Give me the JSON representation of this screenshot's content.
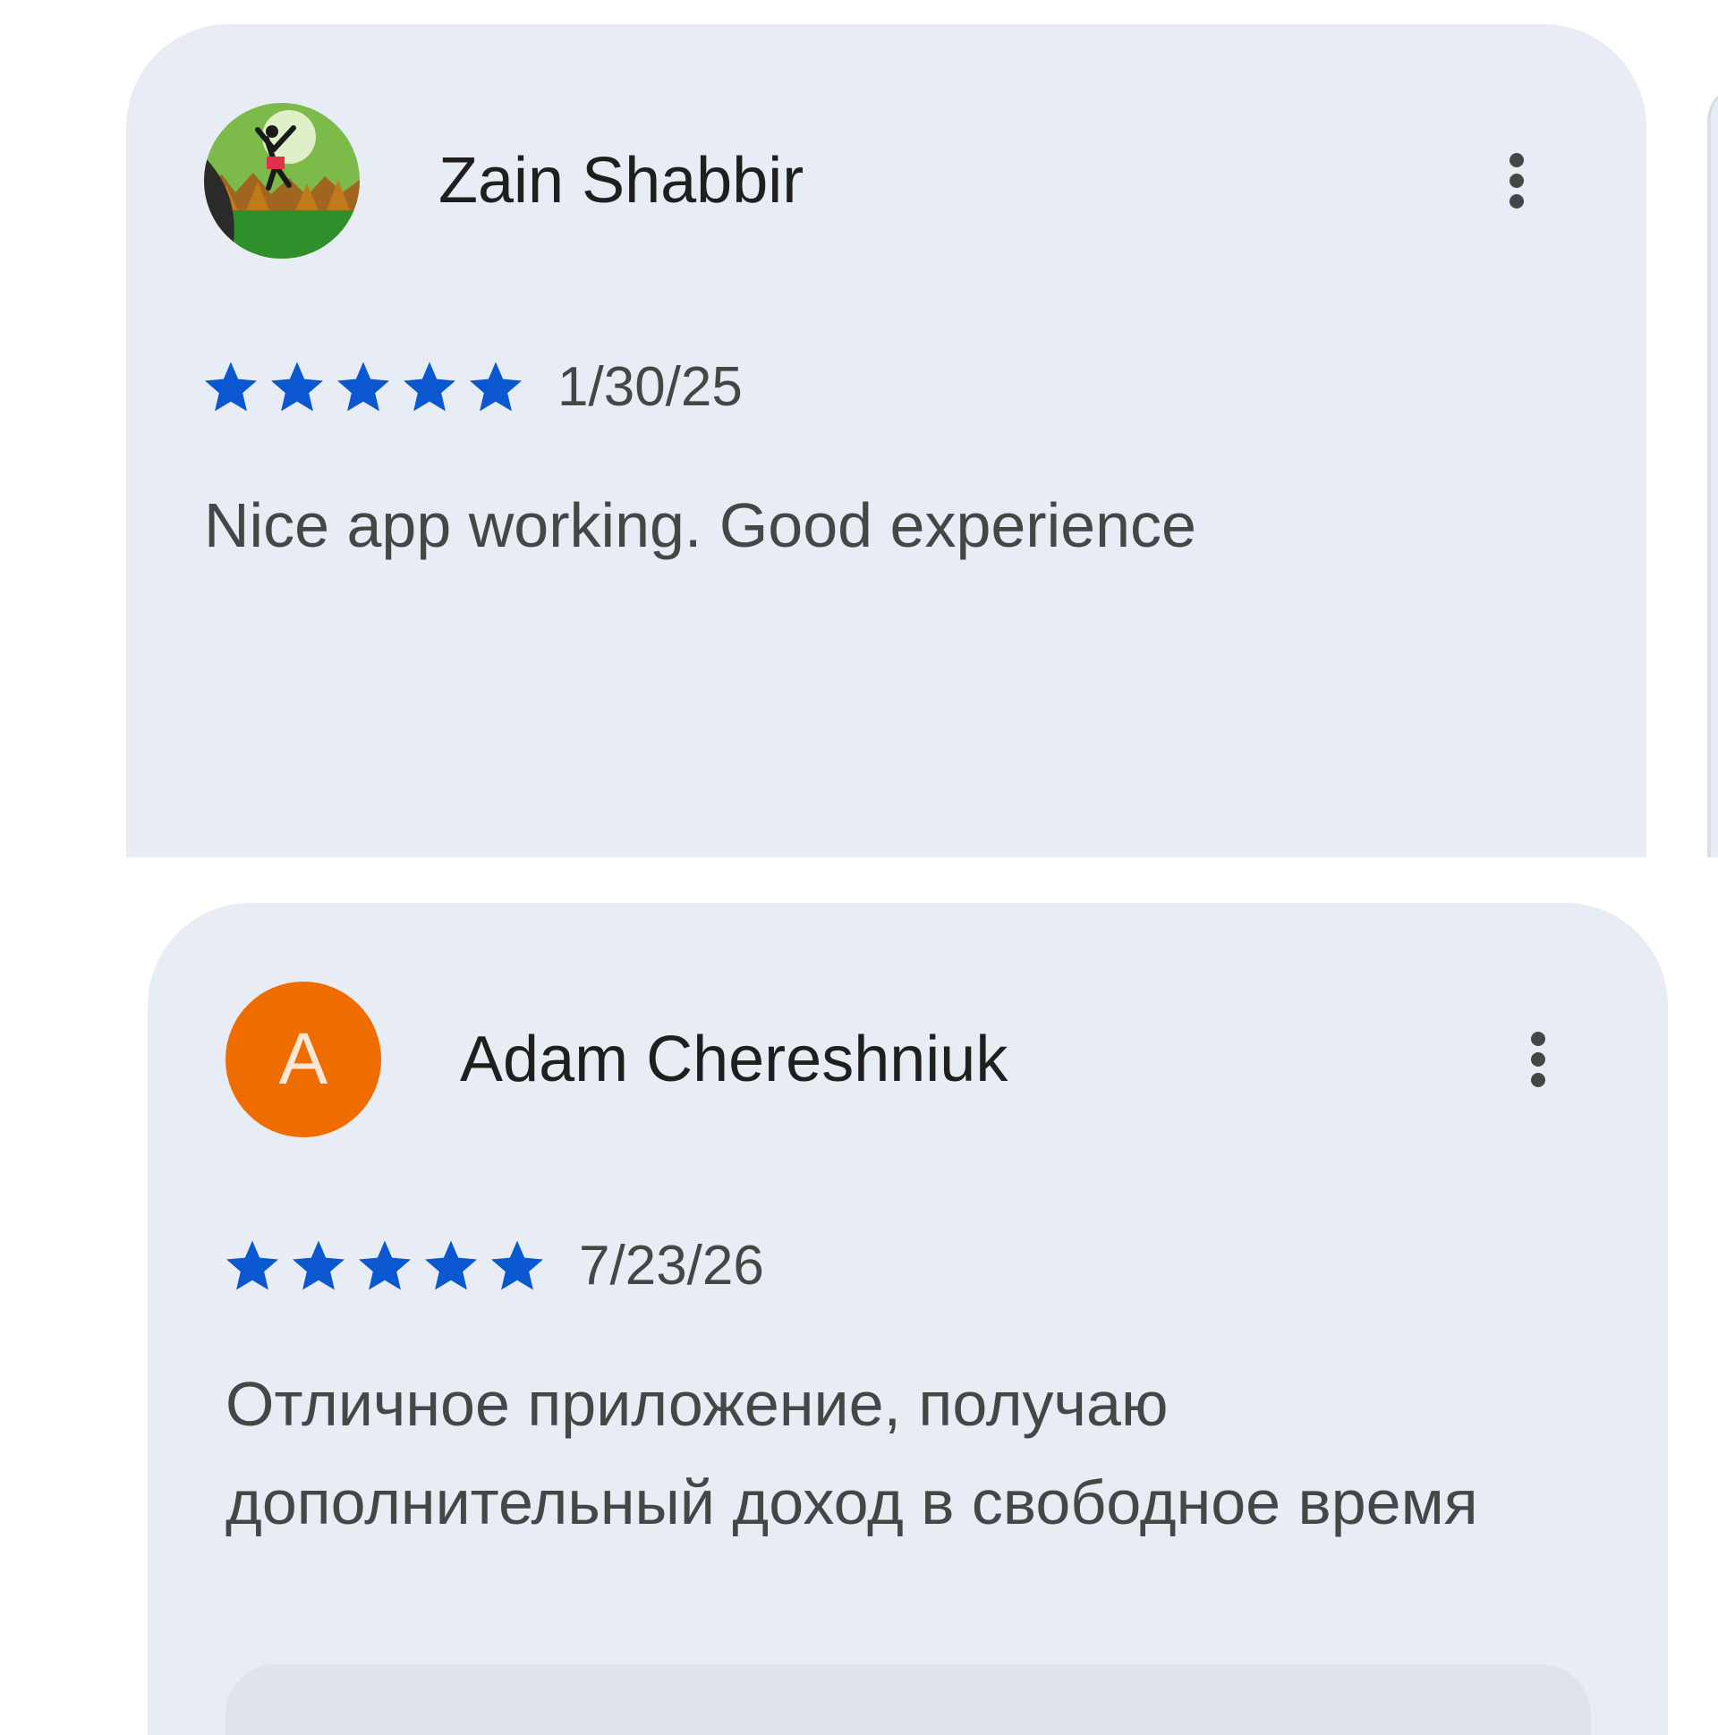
{
  "reviews": [
    {
      "reviewer_name": "Zain Shabbir",
      "avatar": {
        "type": "image",
        "description_icon": "landscape-runner-avatar"
      },
      "rating": 5,
      "max_rating": 5,
      "date": "1/30/25",
      "text": "Nice app working. Good experience",
      "menu_icon": "more-vertical-icon"
    },
    {
      "reviewer_name": "Adam Chereshniuk",
      "avatar": {
        "type": "letter",
        "letter": "A",
        "color": "#ee6c00"
      },
      "rating": 5,
      "max_rating": 5,
      "date": "7/23/26",
      "text": "Отличное приложение, получаю дополнительный доход в свободное время",
      "menu_icon": "more-vertical-icon"
    }
  ],
  "colors": {
    "card_background": "#e8ecf5",
    "star": "#0b57d0",
    "name_text": "#1f1f1f",
    "secondary_text": "#444746"
  }
}
